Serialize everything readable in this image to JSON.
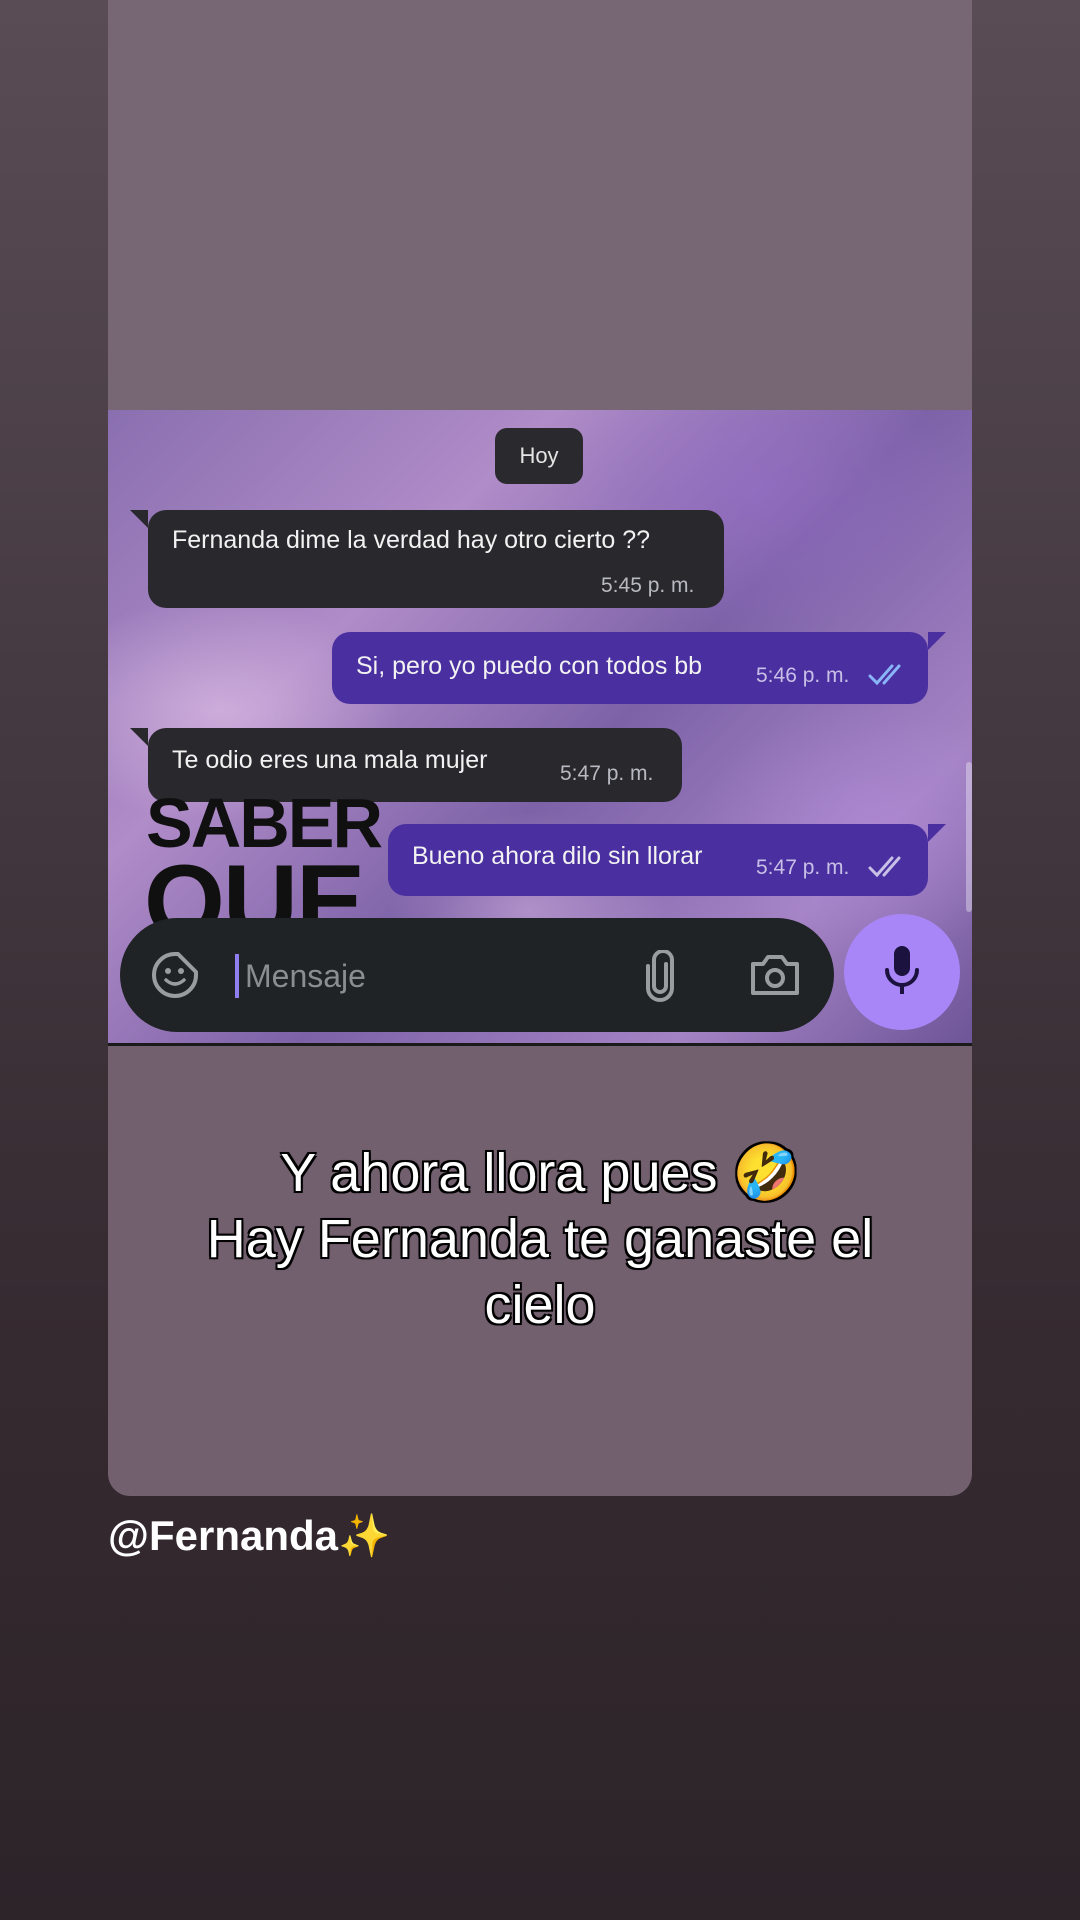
{
  "chat": {
    "date_label": "Hoy",
    "messages": [
      {
        "text": "Fernanda dime la verdad hay otro cierto ??",
        "time": "5:45 p. m."
      },
      {
        "text": "Si, pero yo puedo con todos bb",
        "time": "5:46 p. m."
      },
      {
        "text": "Te odio eres una mala mujer",
        "time": "5:47 p. m."
      },
      {
        "text": "Bueno ahora dilo sin llorar",
        "time": "5:47 p. m."
      }
    ],
    "input_placeholder": "Mensaje"
  },
  "overlay": {
    "line1": "SABER",
    "line2": "QUE"
  },
  "caption": {
    "line1": "Y ahora llora pues 🤣",
    "line2": "Hay Fernanda te ganaste el",
    "line3": "cielo"
  },
  "username": "@Fernanda✨",
  "colors": {
    "incoming_bubble": "#29292d",
    "outgoing_bubble": "#4a2fa0",
    "mic_button": "#a886f7",
    "read_ticks": "#8ab4f8"
  }
}
